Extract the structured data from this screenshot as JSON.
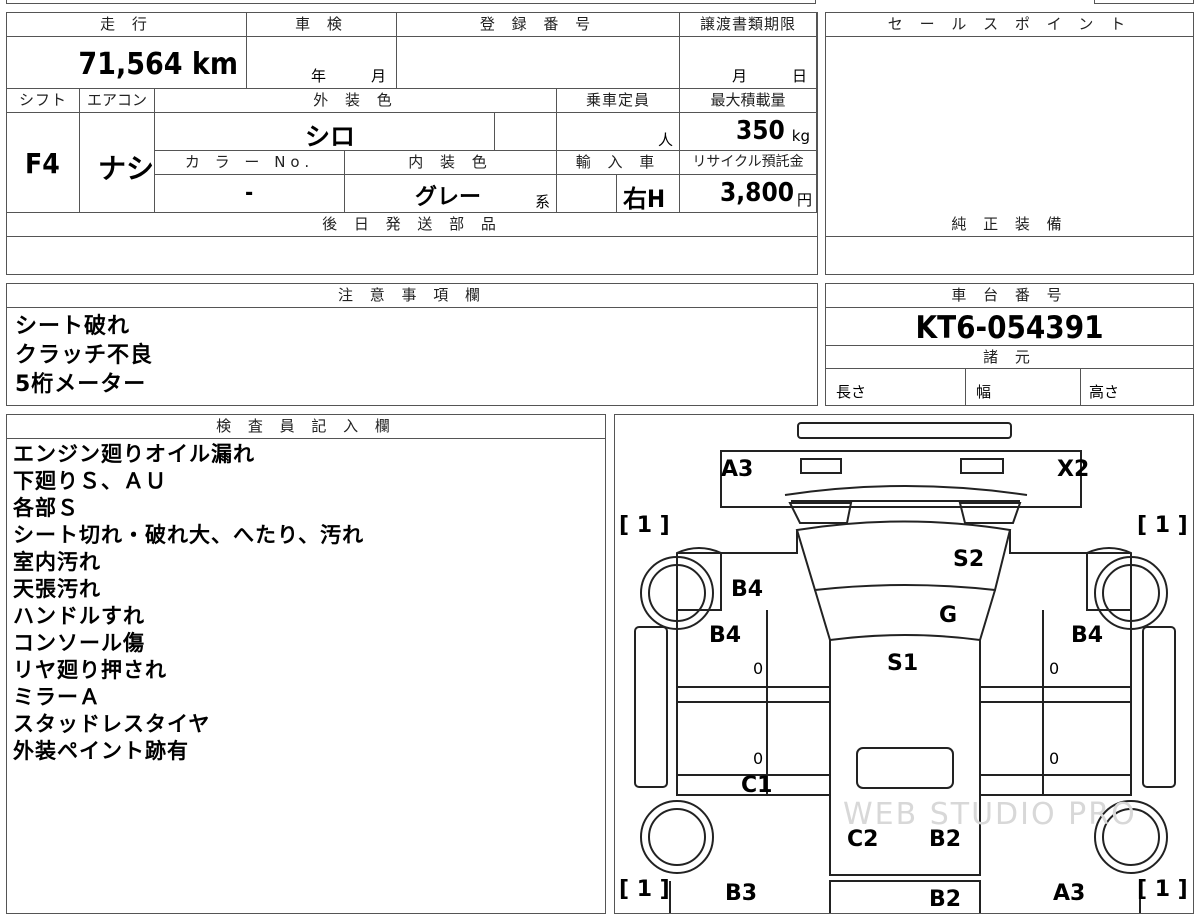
{
  "mileage": {
    "label": "走 行",
    "value": "71,564 km"
  },
  "inspection": {
    "label": "車 検",
    "year_label": "年",
    "month_label": "月"
  },
  "registration": {
    "label": "登 録 番 号",
    "value": ""
  },
  "transfer": {
    "label": "譲渡書類期限",
    "month_label": "月",
    "day_label": "日"
  },
  "sales_point": {
    "label": "セ ー ル ス ポ イ ン ト"
  },
  "shift": {
    "label": "シフト",
    "value": "F4"
  },
  "aircon": {
    "label": "エアコン",
    "value": "ナシ"
  },
  "exterior_color": {
    "label": "外 装 色",
    "value": "シロ"
  },
  "capacity": {
    "label": "乗車定員",
    "unit": "人",
    "value": ""
  },
  "max_load": {
    "label": "最大積載量",
    "value": "350",
    "unit": "kg"
  },
  "color_no": {
    "label": "カ ラ ー No.",
    "value": "-"
  },
  "interior_color": {
    "label": "内 装 色",
    "value": "グレー",
    "suffix": "系"
  },
  "import": {
    "label": "輸 入 車",
    "value": "右H"
  },
  "recycle": {
    "label": "リサイクル預託金",
    "value": "3,800",
    "unit": "円"
  },
  "later_parts": {
    "label": "後 日 発 送 部 品"
  },
  "genuine_equipment": {
    "label": "純 正 装 備"
  },
  "notes": {
    "label": "注 意 事 項 欄",
    "items": [
      "シート破れ",
      "クラッチ不良",
      "5桁メーター"
    ]
  },
  "chassis": {
    "label": "車 台 番 号",
    "value": "KT6-054391"
  },
  "specs": {
    "label": "諸 元",
    "length": "長さ",
    "width": "幅",
    "height": "高さ"
  },
  "inspector": {
    "label": "検 査 員 記 入 欄",
    "items": [
      "エンジン廻りオイル漏れ",
      "下廻りＳ、ＡＵ",
      "各部Ｓ",
      "シート切れ・破れ大、へたり、汚れ",
      "室内汚れ",
      "天張汚れ",
      "ハンドルすれ",
      "コンソール傷",
      "リヤ廻り押され",
      "ミラーＡ",
      "スタッドレスタイヤ",
      "外装ペイント跡有"
    ]
  },
  "diagram": {
    "marks": {
      "a3_top": "A3",
      "x2": "X2",
      "s2": "S2",
      "b4_left_upper": "B4",
      "g": "G",
      "b4_left": "B4",
      "b4_right": "B4",
      "s1": "S1",
      "c1": "C1",
      "c2": "C2",
      "b2_center": "B2",
      "b3": "B3",
      "b2_bottom": "B2",
      "a3_bottom": "A3"
    },
    "tires": {
      "front_left": "[ 1 ]",
      "front_right": "[ 1 ]",
      "rear_left": "[ 1 ]",
      "rear_right": "[ 1 ]"
    },
    "zero_marks": [
      "0",
      "0",
      "0",
      "0"
    ],
    "watermark": "WEB STUDIO PRO"
  }
}
